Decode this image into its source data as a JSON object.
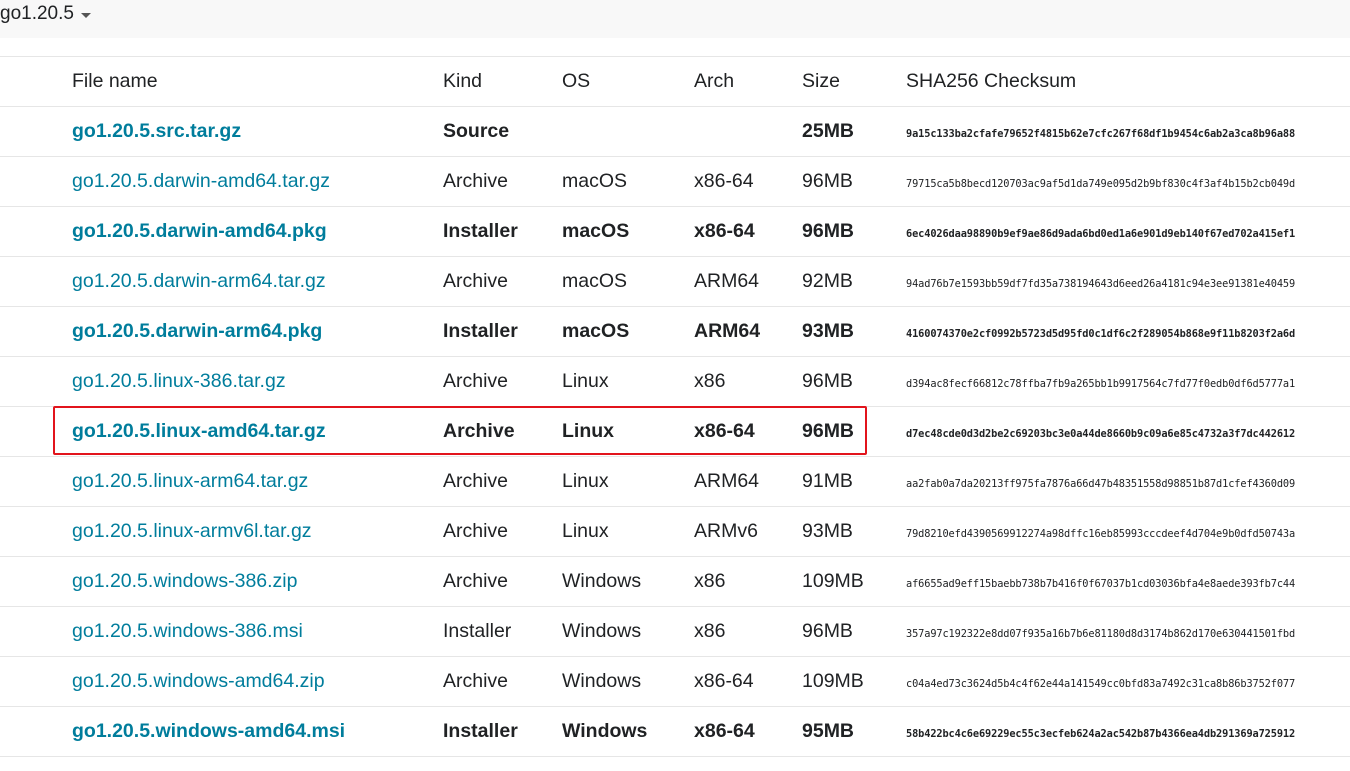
{
  "version_toggle": {
    "label": "go1.20.5"
  },
  "table": {
    "headers": {
      "file_name": "File name",
      "kind": "Kind",
      "os": "OS",
      "arch": "Arch",
      "size": "Size",
      "checksum": "SHA256 Checksum"
    },
    "rows": [
      {
        "file": "go1.20.5.src.tar.gz",
        "kind": "Source",
        "os": "",
        "arch": "",
        "size": "25MB",
        "checksum": "9a15c133ba2cfafe79652f4815b62e7cfc267f68df1b9454c6ab2a3ca8b96a88",
        "featured": true
      },
      {
        "file": "go1.20.5.darwin-amd64.tar.gz",
        "kind": "Archive",
        "os": "macOS",
        "arch": "x86-64",
        "size": "96MB",
        "checksum": "79715ca5b8becd120703ac9af5d1da749e095d2b9bf830c4f3af4b15b2cb049d",
        "featured": false
      },
      {
        "file": "go1.20.5.darwin-amd64.pkg",
        "kind": "Installer",
        "os": "macOS",
        "arch": "x86-64",
        "size": "96MB",
        "checksum": "6ec4026daa98890b9ef9ae86d9ada6bd0ed1a6e901d9eb140f67ed702a415ef1",
        "featured": true
      },
      {
        "file": "go1.20.5.darwin-arm64.tar.gz",
        "kind": "Archive",
        "os": "macOS",
        "arch": "ARM64",
        "size": "92MB",
        "checksum": "94ad76b7e1593bb59df7fd35a738194643d6eed26a4181c94e3ee91381e40459",
        "featured": false
      },
      {
        "file": "go1.20.5.darwin-arm64.pkg",
        "kind": "Installer",
        "os": "macOS",
        "arch": "ARM64",
        "size": "93MB",
        "checksum": "4160074370e2cf0992b5723d5d95fd0c1df6c2f289054b868e9f11b8203f2a6d",
        "featured": true
      },
      {
        "file": "go1.20.5.linux-386.tar.gz",
        "kind": "Archive",
        "os": "Linux",
        "arch": "x86",
        "size": "96MB",
        "checksum": "d394ac8fecf66812c78ffba7fb9a265bb1b9917564c7fd77f0edb0df6d5777a1",
        "featured": false
      },
      {
        "file": "go1.20.5.linux-amd64.tar.gz",
        "kind": "Archive",
        "os": "Linux",
        "arch": "x86-64",
        "size": "96MB",
        "checksum": "d7ec48cde0d3d2be2c69203bc3e0a44de8660b9c09a6e85c4732a3f7dc442612",
        "featured": true
      },
      {
        "file": "go1.20.5.linux-arm64.tar.gz",
        "kind": "Archive",
        "os": "Linux",
        "arch": "ARM64",
        "size": "91MB",
        "checksum": "aa2fab0a7da20213ff975fa7876a66d47b48351558d98851b87d1cfef4360d09",
        "featured": false
      },
      {
        "file": "go1.20.5.linux-armv6l.tar.gz",
        "kind": "Archive",
        "os": "Linux",
        "arch": "ARMv6",
        "size": "93MB",
        "checksum": "79d8210efd4390569912274a98dffc16eb85993cccdeef4d704e9b0dfd50743a",
        "featured": false
      },
      {
        "file": "go1.20.5.windows-386.zip",
        "kind": "Archive",
        "os": "Windows",
        "arch": "x86",
        "size": "109MB",
        "checksum": "af6655ad9eff15baebb738b7b416f0f67037b1cd03036bfa4e8aede393fb7c44",
        "featured": false
      },
      {
        "file": "go1.20.5.windows-386.msi",
        "kind": "Installer",
        "os": "Windows",
        "arch": "x86",
        "size": "96MB",
        "checksum": "357a97c192322e8dd07f935a16b7b6e81180d8d3174b862d170e630441501fbd",
        "featured": false
      },
      {
        "file": "go1.20.5.windows-amd64.zip",
        "kind": "Archive",
        "os": "Windows",
        "arch": "x86-64",
        "size": "109MB",
        "checksum": "c04a4ed73c3624d5b4c4f62e44a141549cc0bfd83a7492c31ca8b86b3752f077",
        "featured": false
      },
      {
        "file": "go1.20.5.windows-amd64.msi",
        "kind": "Installer",
        "os": "Windows",
        "arch": "x86-64",
        "size": "95MB",
        "checksum": "58b422bc4c6e69229ec55c3ecfeb624a2ac542b87b4366ea4db291369a725912",
        "featured": true
      }
    ]
  },
  "colors": {
    "link": "#007d9c",
    "highlight_border": "#e2141c",
    "top_bar_bg": "#f8f8f8",
    "row_divider": "#e6e6e6"
  }
}
